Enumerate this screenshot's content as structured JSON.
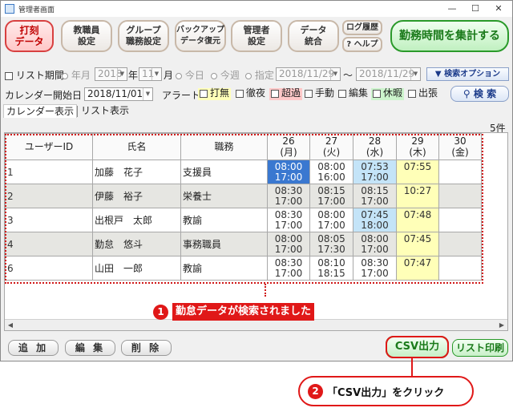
{
  "window": {
    "title": "管理者画面",
    "controls": {
      "minimize": "—",
      "maximize": "☐",
      "close": "✕"
    }
  },
  "toolbar": {
    "punch": "打刻\nデータ",
    "staff": "教職員\n設定",
    "group": "グループ\n職務設定",
    "backup": "バックアップ\nデータ復元",
    "admin": "管理者\n設定",
    "data": "データ\n統合",
    "log": "ログ履歴",
    "help": "? ヘルプ",
    "total": "勤務時間を集計する"
  },
  "filter": {
    "list_period": "リスト期間",
    "month_label": "年月",
    "year_value": "2018",
    "year_unit": "年",
    "month_value": "11",
    "month_unit": "月",
    "today": "今日",
    "this_week": "今週",
    "specify": "指定",
    "date_from": "2018/11/29",
    "tilde": "〜",
    "date_to": "2018/11/29",
    "option_button": "▼ 検索オプション",
    "calendar_start": "カレンダー開始日",
    "calendar_start_value": "2018/11/01",
    "alert": "アラート",
    "alerts": [
      "打無",
      "徹夜",
      "超過",
      "手動",
      "編集",
      "休暇",
      "出張"
    ],
    "search_button": "検 索"
  },
  "tabs": {
    "calendar": "カレンダー表示",
    "list": "リスト表示"
  },
  "count": "5件",
  "grid": {
    "headers": {
      "user_id": "ユーザーID",
      "name": "氏名",
      "role": "職務"
    },
    "days": [
      {
        "day": "26",
        "dow": "(月)"
      },
      {
        "day": "27",
        "dow": "(火)"
      },
      {
        "day": "28",
        "dow": "(水)"
      },
      {
        "day": "29",
        "dow": "(木)"
      },
      {
        "day": "30",
        "dow": "(金)"
      }
    ],
    "rows": [
      {
        "id": "1",
        "name": "加藤　花子",
        "role": "支援員",
        "d26": "08:00\n17:00",
        "d27": "08:00\n16:00",
        "d28": "07:53\n17:00",
        "d29": "07:55",
        "d30": ""
      },
      {
        "id": "2",
        "name": "伊藤　裕子",
        "role": "栄養士",
        "d26": "08:30\n17:00",
        "d27": "08:15\n17:00",
        "d28": "08:15\n17:00",
        "d29": "10:27",
        "d30": ""
      },
      {
        "id": "3",
        "name": "出根戸　太郎",
        "role": "教諭",
        "d26": "08:30\n17:00",
        "d27": "08:00\n17:00",
        "d28": "07:45\n18:00",
        "d29": "07:48",
        "d30": ""
      },
      {
        "id": "4",
        "name": "勤怠　悠斗",
        "role": "事務職員",
        "d26": "08:00\n17:00",
        "d27": "08:05\n17:30",
        "d28": "08:00\n17:00",
        "d29": "07:45",
        "d30": ""
      },
      {
        "id": "6",
        "name": "山田　一郎",
        "role": "教諭",
        "d26": "08:30\n17:00",
        "d27": "08:10\n18:15",
        "d28": "08:30\n17:00",
        "d29": "07:47",
        "d30": ""
      }
    ]
  },
  "callout1": {
    "number": "1",
    "text": "勤怠データが検索されました"
  },
  "callout2": {
    "number": "2",
    "text": "「CSV出力」をクリック"
  },
  "bottom": {
    "add": "追 加",
    "edit": "編 集",
    "delete": "削 除",
    "csv": "CSV出力",
    "print": "リスト印刷"
  },
  "colors": {
    "accent_red": "#e01818",
    "selected_cell": "#3a78d0",
    "highlight_cyan": "#c4e4f8",
    "highlight_yellow": "#ffffb8",
    "green_button": "#2a9a2a"
  }
}
